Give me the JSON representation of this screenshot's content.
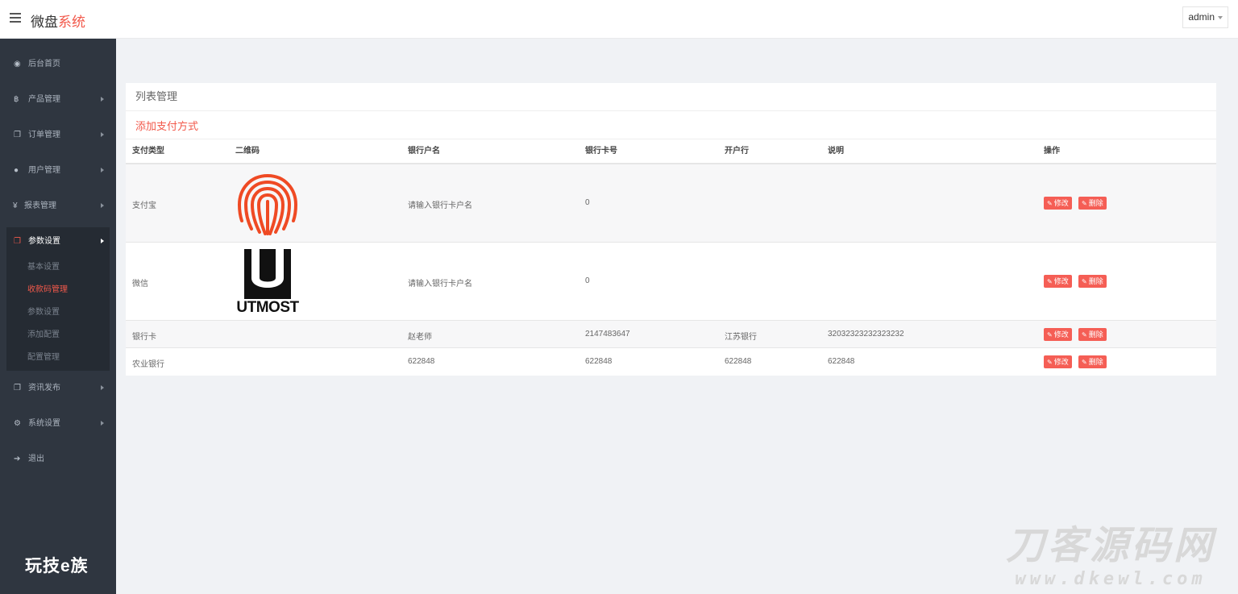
{
  "header": {
    "brand_main": "微盘",
    "brand_accent": "系统",
    "user": "admin"
  },
  "sidebar": {
    "items": [
      {
        "icon": "dashboard-icon",
        "label": "后台首页"
      },
      {
        "icon": "bitcoin-icon",
        "label": "产品管理"
      },
      {
        "icon": "copy-icon",
        "label": "订单管理"
      },
      {
        "icon": "user-icon",
        "label": "用户管理"
      },
      {
        "icon": "yen-icon",
        "label": "报表管理"
      },
      {
        "icon": "copy-icon",
        "label": "参数设置"
      },
      {
        "icon": "copy-icon",
        "label": "资讯发布"
      },
      {
        "icon": "cogs-icon",
        "label": "系统设置"
      },
      {
        "icon": "sign-out-icon",
        "label": "退出"
      }
    ],
    "sub_items": [
      "基本设置",
      "收款码管理",
      "参数设置",
      "添加配置",
      "配置管理"
    ],
    "current_sub": "收款码管理"
  },
  "panel": {
    "title": "列表管理",
    "add_link": "添加支付方式",
    "columns": [
      "支付类型",
      "二维码",
      "银行户名",
      "银行卡号",
      "开户行",
      "说明",
      "操作"
    ],
    "rows": [
      {
        "type": "支付宝",
        "qr": "fingerprint-image",
        "account_name": "请输入银行卡户名",
        "card_no": "0",
        "bank": "",
        "note": ""
      },
      {
        "type": "微信",
        "qr": "utmost-logo-image",
        "qr_text": "UTMOST",
        "account_name": "请输入银行卡户名",
        "card_no": "0",
        "bank": "",
        "note": ""
      },
      {
        "type": "银行卡",
        "qr": "",
        "account_name": "赵老师",
        "card_no": "2147483647",
        "bank": "江苏银行",
        "note": "32032323232323232"
      },
      {
        "type": "农业银行",
        "qr": "",
        "account_name": "622848",
        "card_no": "622848",
        "bank": "622848",
        "note": "622848"
      }
    ],
    "edit_label": "修改",
    "delete_label": "删除"
  },
  "watermarks": {
    "left": "玩技e族",
    "right_big": "刀客源码网",
    "right_small": "www.dkewl.com"
  },
  "colors": {
    "accent": "#f2594b",
    "sidebar_bg": "#2f3640",
    "button_bg": "#f55e55"
  }
}
